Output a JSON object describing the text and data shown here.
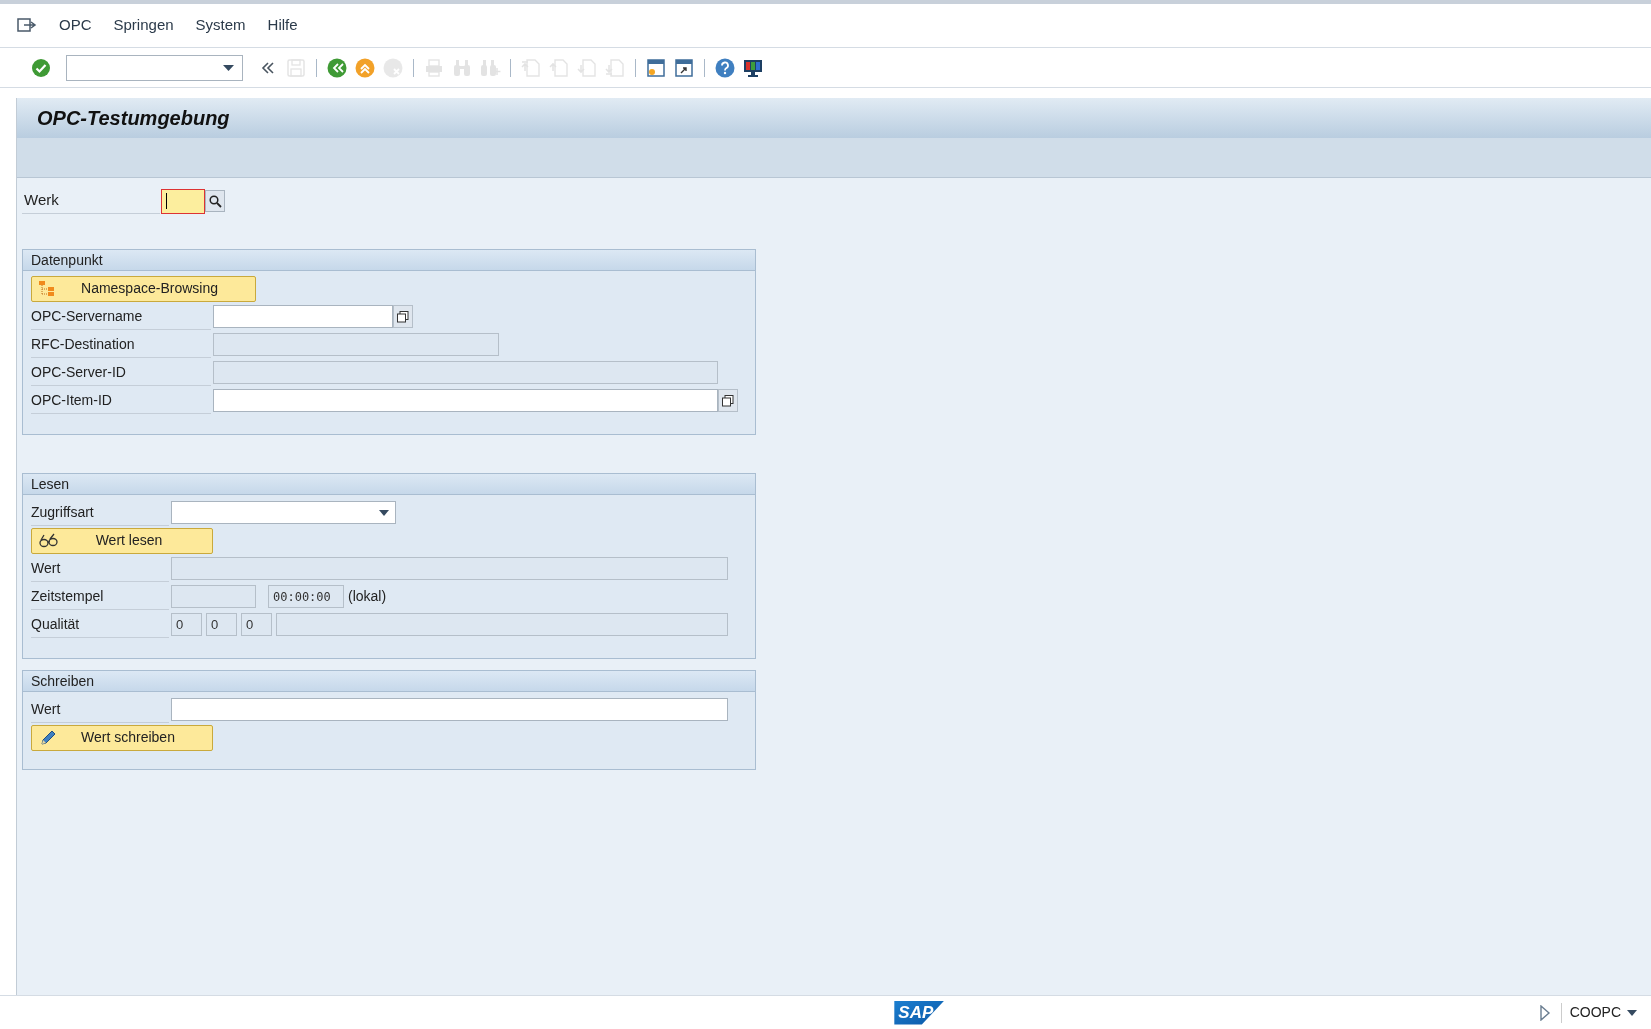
{
  "menu": [
    {
      "label": "OPC"
    },
    {
      "label": "Springen"
    },
    {
      "label": "System"
    },
    {
      "label": "Hilfe"
    }
  ],
  "toolbar": [
    {
      "kind": "enter",
      "disabled": false
    },
    {
      "kind": "command",
      "disabled": false
    },
    {
      "kind": "collapse",
      "disabled": false
    },
    {
      "kind": "save",
      "disabled": true
    },
    {
      "kind": "sep"
    },
    {
      "kind": "back",
      "disabled": false
    },
    {
      "kind": "exit",
      "disabled": false
    },
    {
      "kind": "cancel",
      "disabled": true
    },
    {
      "kind": "sep"
    },
    {
      "kind": "print",
      "disabled": true
    },
    {
      "kind": "find",
      "disabled": true
    },
    {
      "kind": "findnext",
      "disabled": true
    },
    {
      "kind": "sep"
    },
    {
      "kind": "first",
      "disabled": true
    },
    {
      "kind": "prev",
      "disabled": true
    },
    {
      "kind": "next",
      "disabled": true
    },
    {
      "kind": "last",
      "disabled": true
    },
    {
      "kind": "sep"
    },
    {
      "kind": "session",
      "disabled": false
    },
    {
      "kind": "shortcut",
      "disabled": false
    },
    {
      "kind": "sep"
    },
    {
      "kind": "help",
      "disabled": false
    },
    {
      "kind": "layout",
      "disabled": false
    }
  ],
  "title": "OPC-Testumgebung",
  "werk": {
    "label": "Werk",
    "focused": true
  },
  "sections": [
    {
      "title": "Datenpunkt",
      "rows": [
        {
          "kind": "button",
          "label": "Namespace-Browsing"
        },
        {
          "kind": "fields",
          "label": "OPC-Servername",
          "fields": [
            {
              "disabled": false,
              "help_button": true
            }
          ]
        },
        {
          "kind": "fields",
          "label": "RFC-Destination",
          "fields": [
            {
              "disabled": true
            }
          ]
        },
        {
          "kind": "fields",
          "label": "OPC-Server-ID",
          "fields": [
            {
              "disabled": true
            }
          ]
        },
        {
          "kind": "fields",
          "label": "OPC-Item-ID",
          "fields": [
            {
              "disabled": false,
              "help_button": true
            }
          ]
        }
      ]
    },
    {
      "title": "Lesen",
      "rows": [
        {
          "kind": "dropdown",
          "label": "Zugriffsart"
        },
        {
          "kind": "button",
          "label": "Wert lesen"
        },
        {
          "kind": "fields",
          "label": "Wert",
          "fields": [
            {
              "disabled": true
            }
          ]
        },
        {
          "kind": "fields",
          "label": "Zeitstempel",
          "fields": [
            {
              "disabled": true
            },
            {
              "disabled": true,
              "value": "00:00:00"
            }
          ],
          "note": "(lokal)"
        },
        {
          "kind": "fields",
          "label": "Qualität",
          "fields": [
            {
              "disabled": true,
              "value": "0"
            },
            {
              "disabled": true,
              "value": "0"
            },
            {
              "disabled": true,
              "value": "0"
            },
            {
              "disabled": true
            }
          ]
        }
      ]
    },
    {
      "title": "Schreiben",
      "rows": [
        {
          "kind": "fields",
          "label": "Wert",
          "fields": [
            {
              "disabled": false
            }
          ]
        },
        {
          "kind": "button",
          "label": "Wert schreiben"
        }
      ]
    }
  ],
  "status_bar": {
    "logo": "SAP",
    "system": "COOPC"
  }
}
